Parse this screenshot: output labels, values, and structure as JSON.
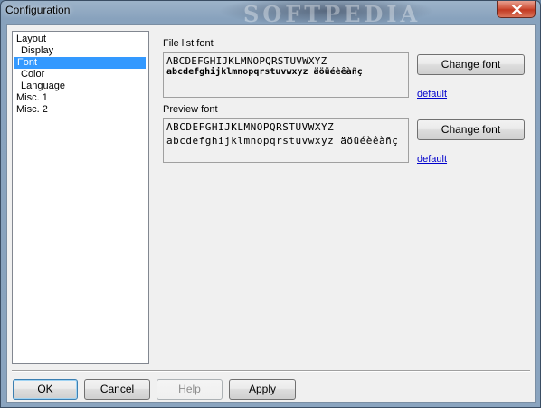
{
  "window": {
    "title": "Configuration",
    "watermark": "SOFTPEDIA"
  },
  "tree": {
    "items": [
      {
        "label": "Layout",
        "selected": false
      },
      {
        "label": "Display",
        "selected": false
      },
      {
        "label": "Font",
        "selected": true
      },
      {
        "label": "Color",
        "selected": false
      },
      {
        "label": "Language",
        "selected": false
      },
      {
        "label": "Misc. 1",
        "selected": false
      },
      {
        "label": "Misc. 2",
        "selected": false
      }
    ]
  },
  "file_list_font": {
    "label": "File list font",
    "sample_upper": "ABCDEFGHIJKLMNOPQRSTUVWXYZ",
    "sample_lower": "abcdefghijklmnopqrstuvwxyz äöüéèêàñç",
    "button": "Change font",
    "link": "default"
  },
  "preview_font": {
    "label": "Preview font",
    "sample_upper": "ABCDEFGHIJKLMNOPQRSTUVWXYZ",
    "sample_lower": "abcdefghijklmnopqrstuvwxyz äöüéèêàñç",
    "button": "Change font",
    "link": "default"
  },
  "footer": {
    "ok": "OK",
    "cancel": "Cancel",
    "help": "Help",
    "apply": "Apply"
  },
  "colors": {
    "selection": "#3399ff",
    "link": "#0000cc",
    "dialog_bg": "#f0f0f0"
  }
}
